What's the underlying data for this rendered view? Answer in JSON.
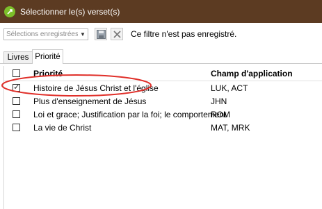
{
  "window": {
    "title": "Sélectionner le(s) verset(s)"
  },
  "toolbar": {
    "saved_selections_placeholder": "Sélections enregistrées",
    "status": "Ce filtre n'est pas enregistré."
  },
  "tabs": [
    {
      "label": "Livres",
      "active": false
    },
    {
      "label": "Priorité",
      "active": true
    }
  ],
  "grid": {
    "columns": {
      "priority": "Priorité",
      "scope": "Champ d'application"
    },
    "rows": [
      {
        "priority": "Histoire de Jésus Christ et l'église",
        "scope": "LUK, ACT",
        "checked": true
      },
      {
        "priority": "Plus d'enseignement de Jésus",
        "scope": "JHN",
        "checked": false
      },
      {
        "priority": "Loi et grace; Justification par la foi; le comportement",
        "scope": "ROM",
        "checked": false
      },
      {
        "priority": "La vie de Christ",
        "scope": "MAT, MRK",
        "checked": false
      }
    ]
  },
  "colors": {
    "titlebar": "#5c3b22",
    "annotation": "#e0302a"
  }
}
